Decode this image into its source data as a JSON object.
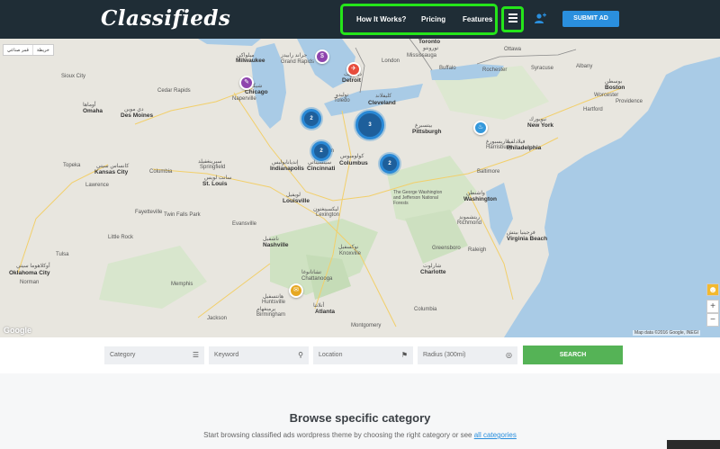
{
  "header": {
    "logo": "Classifieds",
    "nav": [
      "How It Works?",
      "Pricing",
      "Features"
    ],
    "submit_label": "SUBMIT AD",
    "menu_icon": "hamburger-icon",
    "add_user_icon": "add-user-icon"
  },
  "map": {
    "type_buttons": [
      "خريطة",
      "قمر صناعي"
    ],
    "attribution": "Map data ©2016 Google, INEGI",
    "google": "Google",
    "labels": [
      {
        "t": "Toronto"
      },
      {
        "t": "تورونتو"
      },
      {
        "t": "Mississauga"
      },
      {
        "t": "Milwaukee"
      },
      {
        "t": "ميلواكي"
      },
      {
        "t": "Grand Rapids"
      },
      {
        "t": "جراند رابيدز"
      },
      {
        "t": "London"
      },
      {
        "t": "Detroit"
      },
      {
        "t": "ديترويت"
      },
      {
        "t": "Chicago"
      },
      {
        "t": "شيكاغو"
      },
      {
        "t": "Naperville"
      },
      {
        "t": "Toledo"
      },
      {
        "t": "توليدو"
      },
      {
        "t": "Cleveland"
      },
      {
        "t": "كليفلاند"
      },
      {
        "t": "Buffalo"
      },
      {
        "t": "Rochester"
      },
      {
        "t": "Syracuse"
      },
      {
        "t": "Albany"
      },
      {
        "t": "Boston"
      },
      {
        "t": "بوسطن"
      },
      {
        "t": "Worcester"
      },
      {
        "t": "Providence"
      },
      {
        "t": "Hartford"
      },
      {
        "t": "New York"
      },
      {
        "t": "نيويورك"
      },
      {
        "t": "Philadelphia"
      },
      {
        "t": "فيلادلفيا"
      },
      {
        "t": "Pittsburgh"
      },
      {
        "t": "بيتسبرغ"
      },
      {
        "t": "Baltimore"
      },
      {
        "t": "Washington"
      },
      {
        "t": "واشنطن"
      },
      {
        "t": "Richmond"
      },
      {
        "t": "ريتشموند"
      },
      {
        "t": "Virginia Beach"
      },
      {
        "t": "فرجينيا بيتش"
      },
      {
        "t": "Columbus"
      },
      {
        "t": "كولومبوس"
      },
      {
        "t": "Cincinnati"
      },
      {
        "t": "سينسيناتي"
      },
      {
        "t": "Indianapolis"
      },
      {
        "t": "إنديانابوليس"
      },
      {
        "t": "Dayton"
      },
      {
        "t": "Louisville"
      },
      {
        "t": "لويفيل"
      },
      {
        "t": "Lexington"
      },
      {
        "t": "ليكسينغتون"
      },
      {
        "t": "St. Louis"
      },
      {
        "t": "سانت لويس"
      },
      {
        "t": "Springfield"
      },
      {
        "t": "سبرينغفيلد"
      },
      {
        "t": "Kansas City"
      },
      {
        "t": "كانساس سيتي"
      },
      {
        "t": "Topeka"
      },
      {
        "t": "Lawrence"
      },
      {
        "t": "Columbia"
      },
      {
        "t": "Des Moines"
      },
      {
        "t": "دي موين"
      },
      {
        "t": "Cedar Rapids"
      },
      {
        "t": "Omaha"
      },
      {
        "t": "أوماها"
      },
      {
        "t": "Sioux City"
      },
      {
        "t": "Tulsa"
      },
      {
        "t": "Oklahoma City"
      },
      {
        "t": "أوكلاهوما سيتي"
      },
      {
        "t": "Norman"
      },
      {
        "t": "Nashville"
      },
      {
        "t": "ناشفيل"
      },
      {
        "t": "Knoxville"
      },
      {
        "t": "نوكسفيل"
      },
      {
        "t": "Chattanooga"
      },
      {
        "t": "تشاتانوغا"
      },
      {
        "t": "Huntsville"
      },
      {
        "t": "هانتسفيل"
      },
      {
        "t": "Birmingham"
      },
      {
        "t": "برمنغهام"
      },
      {
        "t": "Atlanta"
      },
      {
        "t": "أتلانتا"
      },
      {
        "t": "Charlotte"
      },
      {
        "t": "شارلوت"
      },
      {
        "t": "Raleigh"
      },
      {
        "t": "Greensboro"
      },
      {
        "t": "Columbia"
      },
      {
        "t": "Evansville"
      },
      {
        "t": "Memphis"
      },
      {
        "t": "Jackson"
      },
      {
        "t": "Little Rock"
      },
      {
        "t": "Fayetteville"
      },
      {
        "t": "Harrisburg"
      },
      {
        "t": "هاريسبورغ"
      },
      {
        "t": "Ottawa"
      },
      {
        "t": "Montgomery"
      },
      {
        "t": "Twin Falls Park"
      },
      {
        "t": "The George Washington and Jefferson National Forests"
      }
    ],
    "clusters": [
      {
        "n": "2"
      },
      {
        "n": "3"
      },
      {
        "n": "2"
      },
      {
        "n": "2"
      }
    ],
    "pins": [
      {
        "icon": "dollar-icon",
        "glyph": "$",
        "color": "#8e44ad"
      },
      {
        "icon": "car-icon",
        "glyph": "✈",
        "color": "#e74c3c"
      },
      {
        "icon": "tag-icon",
        "glyph": "✎",
        "color": "#8e44ad"
      },
      {
        "icon": "gift-icon",
        "glyph": "♨",
        "color": "#3498db"
      },
      {
        "icon": "megaphone-icon",
        "glyph": "✉",
        "color": "#e6a822"
      }
    ]
  },
  "search": {
    "category": "Category",
    "keyword": "Keyword",
    "location": "Location",
    "radius": "Radius (300mi)",
    "button": "SEARCH"
  },
  "lower": {
    "title": "Browse specific category",
    "subtitle": "Start browsing classified ads wordpress theme by choosing the right category or see",
    "link": "all categories"
  },
  "colors": {
    "header": "#1f2d36",
    "accent": "#2a8fde",
    "search": "#55b356",
    "highlight": "#25e51a"
  }
}
